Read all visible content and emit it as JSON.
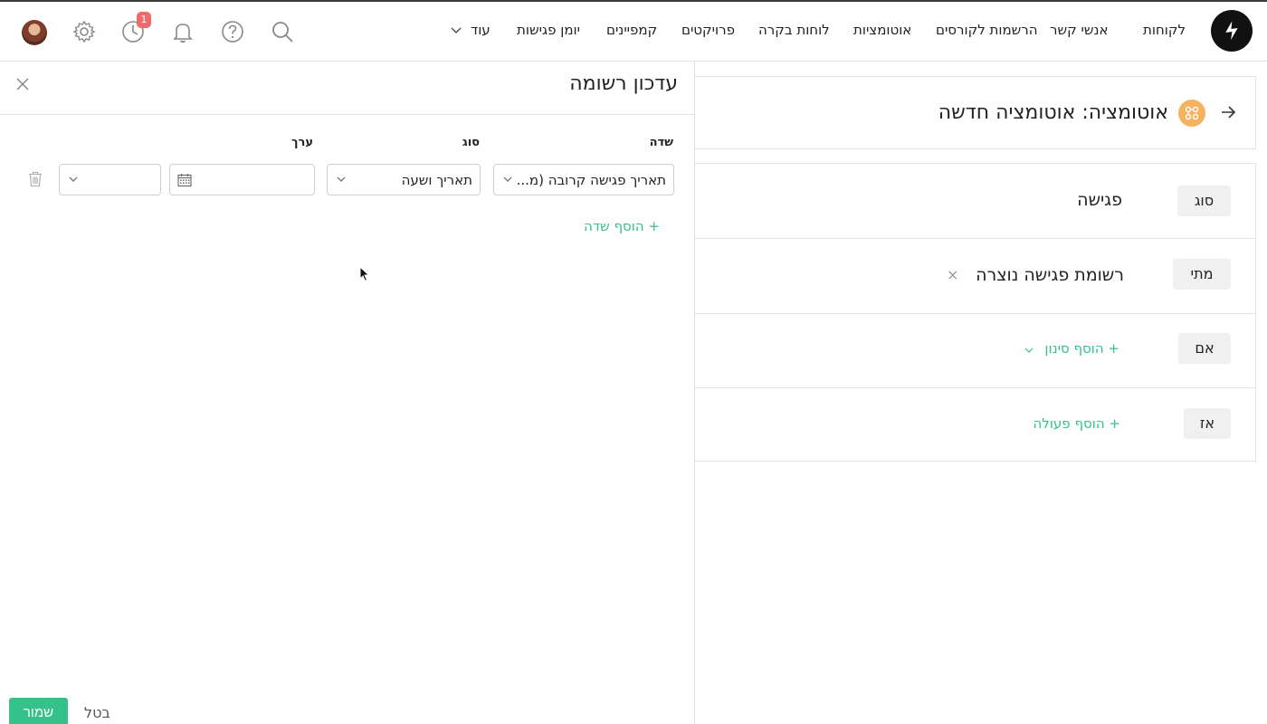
{
  "nav": {
    "items": [
      "לקוחות",
      "אנשי קשר",
      "הרשמות לקורסים",
      "אוטומציות",
      "לוחות בקרה",
      "פרויקטים",
      "קמפיינים",
      "יומן פגישות"
    ],
    "more_label": "עוד",
    "notification_count": "1"
  },
  "automation": {
    "title": "אוטומציה: אוטומציה חדשה",
    "rows": [
      {
        "tag": "סוג",
        "value": "פגישה"
      },
      {
        "tag": "מתי",
        "value": "רשומת פגישה נוצרה",
        "remove": "×"
      },
      {
        "tag": "אם",
        "link": "+  הוסף סינון"
      },
      {
        "tag": "אז",
        "link": "+  הוסף פעולה"
      }
    ]
  },
  "panel": {
    "title": "עדכון רשומה",
    "close": "×",
    "columns": {
      "field": "שדה",
      "type": "סוג",
      "value": "ערך"
    },
    "field_select": "תאריך פגישה קרובה (מ...",
    "type_select": "תאריך ושעה",
    "date_value": "",
    "extra_select": "",
    "add_field": "+  הוסף שדה",
    "save": "שמור",
    "cancel": "בטל"
  },
  "colors": {
    "accent": "#34c28a",
    "badge": "#ef6b6b",
    "automation_icon": "#f4b35f"
  }
}
